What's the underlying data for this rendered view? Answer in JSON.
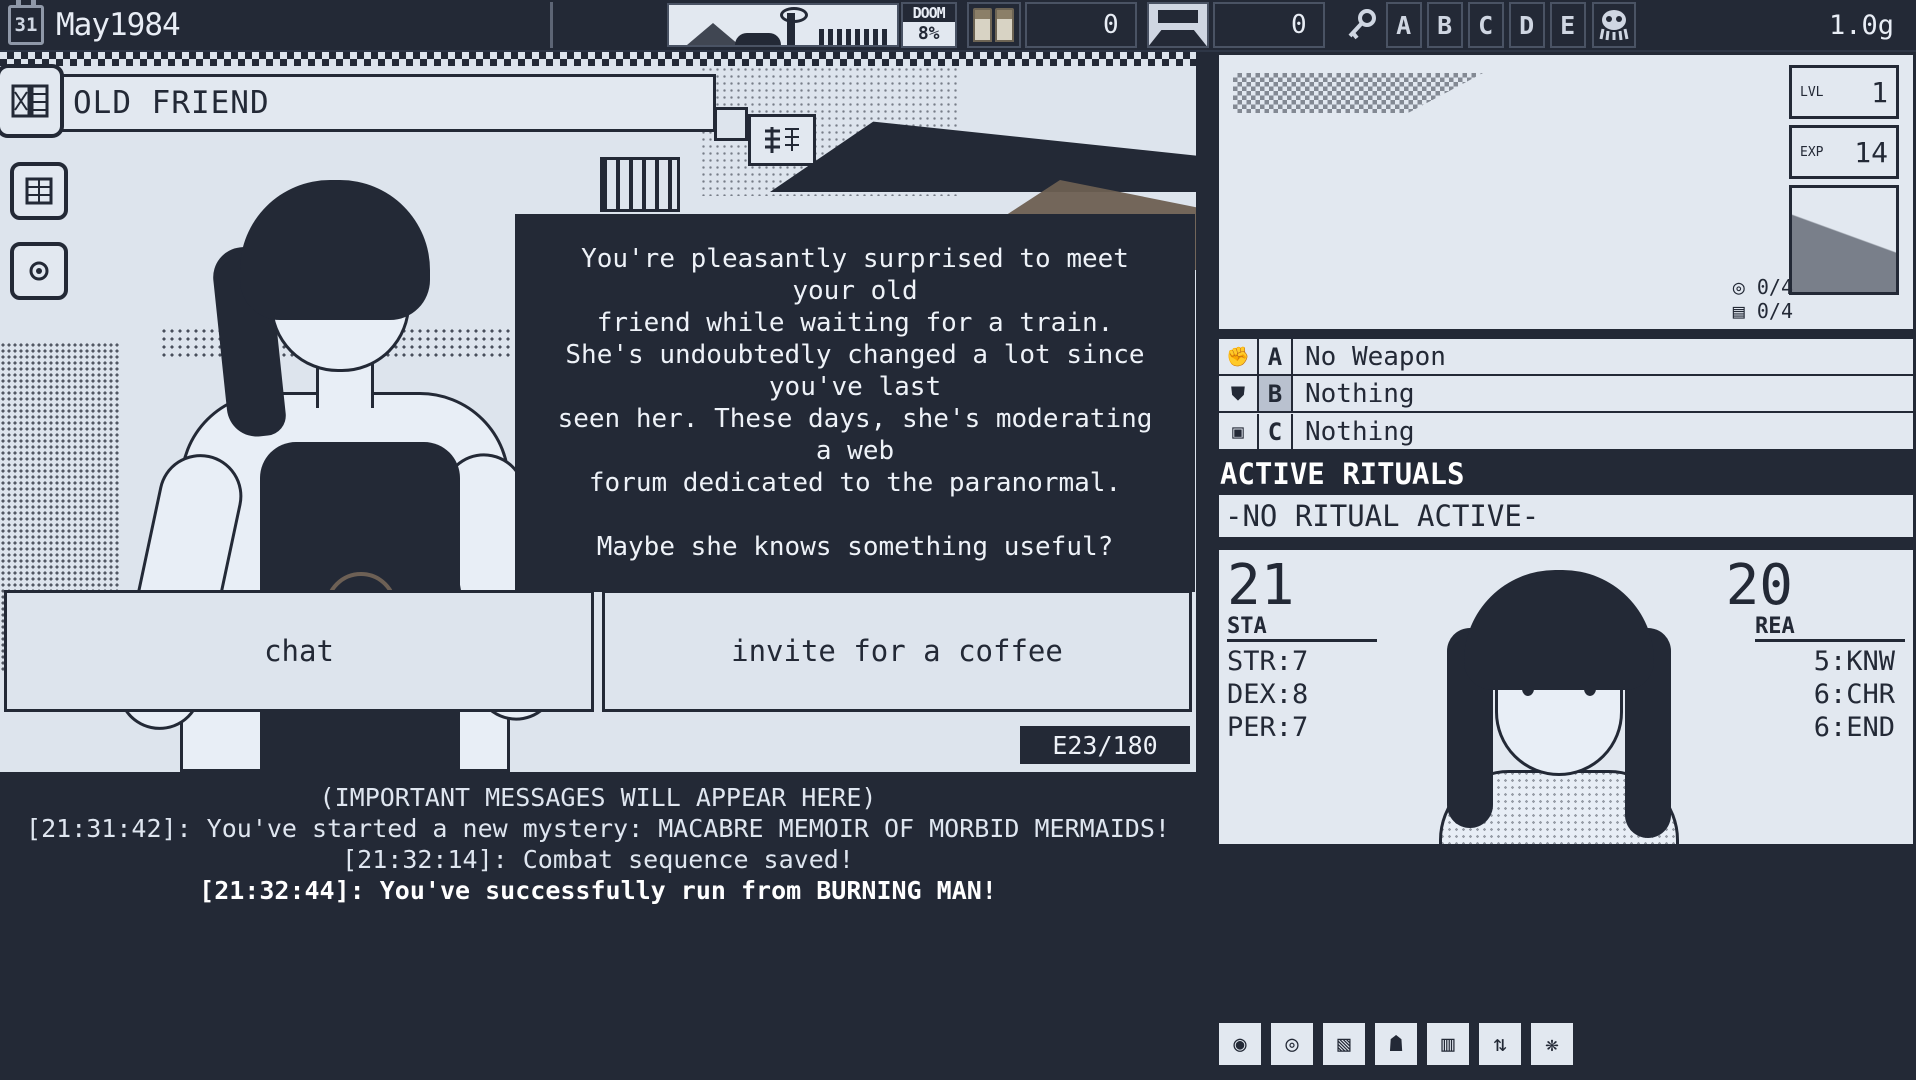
{
  "topbar": {
    "calendar_day": "31",
    "date": "May1984",
    "doom_label": "DOOM",
    "doom_value": "8%",
    "counter_1": "0",
    "counter_2": "0",
    "letter_slots": [
      "A",
      "B",
      "C",
      "D",
      "E"
    ],
    "weight": "1.0g",
    "icons": {
      "calendar": "calendar-icon",
      "scene": "landscape-scene-icon",
      "pills": "pills-icon",
      "locker": "locker-icon",
      "key": "key-icon",
      "octopus": "octopus-icon"
    }
  },
  "scene": {
    "nameplate": "OLD FRIEND",
    "portrait_badge_icon": "face-portrait-icon",
    "side_button_1_icon": "book-icon",
    "side_button_2_icon": "sun-icon",
    "corner_badge_icon": "kanji-badge-icon",
    "dialog_text": "You're pleasantly surprised to meet your old\nfriend while waiting for a train.\nShe's undoubtedly changed a lot since you've last\nseen her. These days, she's moderating a web\nforum dedicated to the paranormal.\n\nMaybe she knows something useful?",
    "choices": [
      {
        "label": "chat"
      },
      {
        "label": "invite for a coffee"
      }
    ],
    "energy": "E23/180"
  },
  "log": {
    "header": "(IMPORTANT MESSAGES WILL APPEAR HERE)",
    "lines": [
      {
        "text": "[21:31:42]: You've started a new mystery: MACABRE MEMOIR OF MORBID MERMAIDS!",
        "highlight": false
      },
      {
        "text": "[21:32:14]: Combat sequence saved!",
        "highlight": false
      },
      {
        "text": "[21:32:44]: You've successfully run from BURNING MAN!",
        "highlight": true
      }
    ]
  },
  "sidebar": {
    "level_label": "LVL",
    "level_value": "1",
    "exp_label": "EXP",
    "exp_value": "14",
    "mini_counters": [
      {
        "icon": "target-icon",
        "value": "0/4"
      },
      {
        "icon": "bag-icon",
        "value": "0/4"
      }
    ],
    "equipment": [
      {
        "key": "A",
        "name": "No Weapon",
        "icon": "fist-icon",
        "selected": false
      },
      {
        "key": "B",
        "name": "Nothing",
        "icon": "armor-icon",
        "selected": true
      },
      {
        "key": "C",
        "name": "Nothing",
        "icon": "scroll-icon",
        "selected": false
      }
    ],
    "rituals_header": "ACTIVE RITUALS",
    "rituals_body": "-NO RITUAL ACTIVE-",
    "stat_left_value": "21",
    "stat_left_label": "STA",
    "stat_left_list": "STR:7\nDEX:8\nPER:7",
    "stat_right_value": "20",
    "stat_right_label": "REA",
    "stat_right_list": "5:KNW\n6:CHR\n6:END",
    "toolbar_icons": [
      "spiral-icon",
      "spiral2-icon",
      "chart-icon",
      "person-icon",
      "building-icon",
      "exchange-icon",
      "octopus-icon"
    ]
  }
}
